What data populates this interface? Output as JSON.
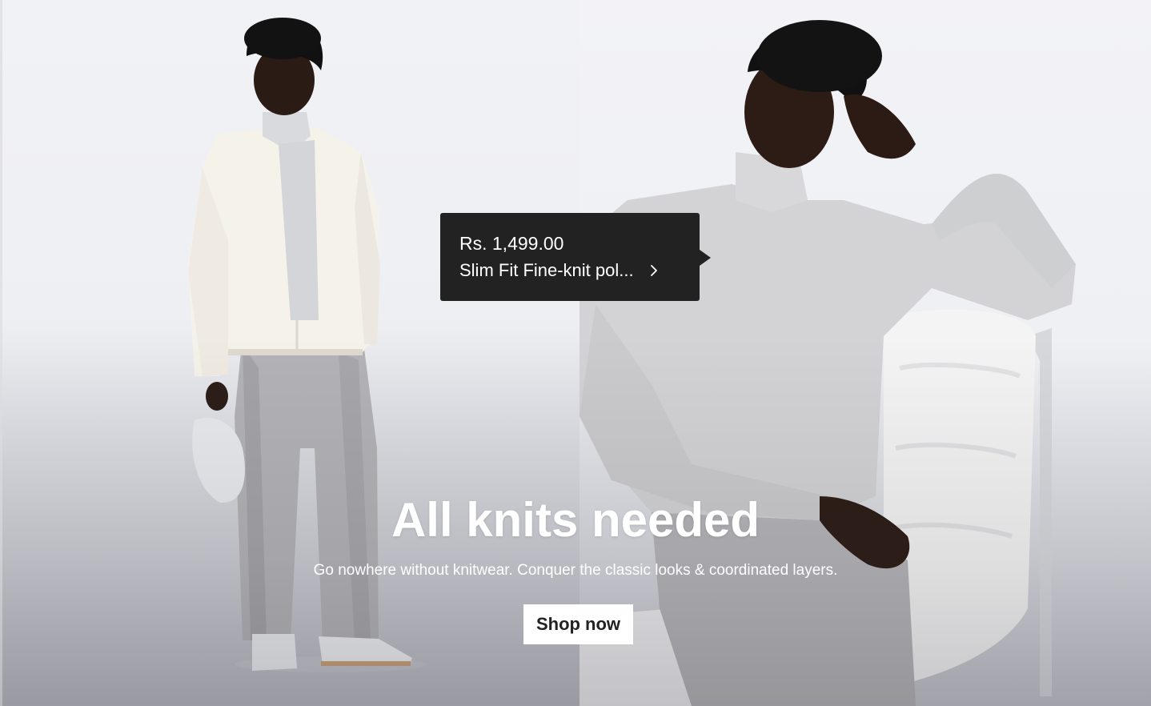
{
  "product_tag": {
    "price": "Rs. 1,499.00",
    "name": "Slim Fit Fine-knit pol...",
    "chevron_icon": "chevron-right-icon"
  },
  "hero": {
    "title": "All knits needed",
    "subtitle": "Go nowhere without knitwear. Conquer the classic looks & coordinated layers.",
    "cta_label": "Shop now"
  },
  "colors": {
    "tag_background": "#222222",
    "text_on_image": "#ffffff",
    "button_background": "#ffffff",
    "button_text": "#222222"
  }
}
